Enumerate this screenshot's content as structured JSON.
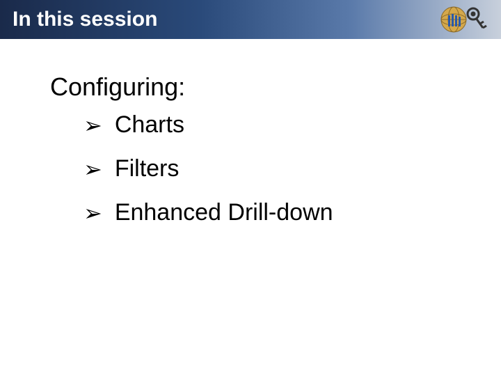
{
  "header": {
    "title": "In this session"
  },
  "content": {
    "subtitle": "Configuring:",
    "bullets": [
      {
        "label": "Charts"
      },
      {
        "label": "Filters"
      },
      {
        "label": "Enhanced Drill-down"
      }
    ]
  }
}
